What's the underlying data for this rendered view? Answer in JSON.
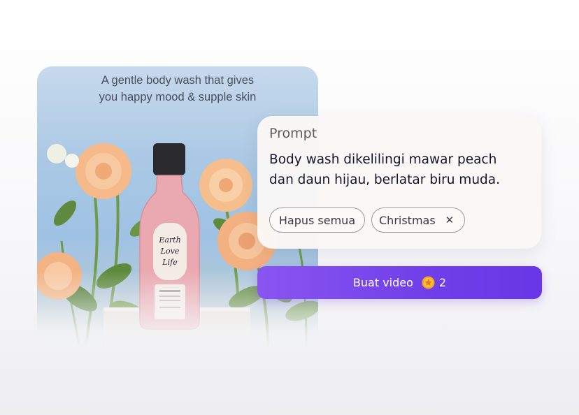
{
  "photo": {
    "caption_line1": "A gentle body wash that gives",
    "caption_line2": "you happy mood & supple skin",
    "bottle_brand": "Earth Love Life"
  },
  "prompt": {
    "label": "Prompt",
    "text_line1": "Body wash dikelilingi mawar peach",
    "text_line2": "dan daun hijau, berlatar biru muda.",
    "chips": {
      "clear_all": "Hapus semua",
      "tag": "Christmas"
    }
  },
  "create_button": {
    "label": "Buat video",
    "cost": "2"
  },
  "colors": {
    "accent": "#7040E8",
    "coin": "#F5A623"
  }
}
